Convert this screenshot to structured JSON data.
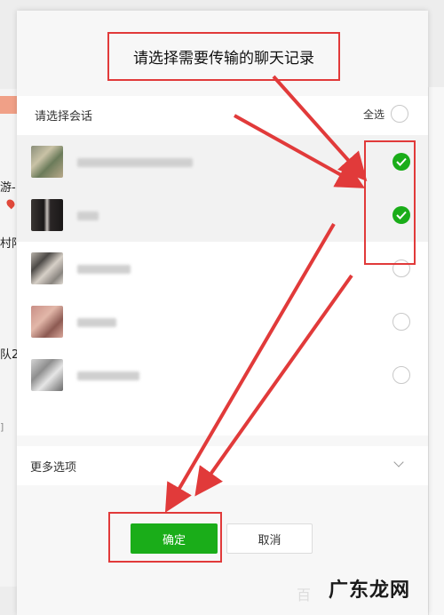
{
  "dialog": {
    "title": "请选择需要传输的聊天记录",
    "list_label": "请选择会话",
    "select_all_label": "全选",
    "more_options_label": "更多选项",
    "confirm_label": "确定",
    "cancel_label": "取消"
  },
  "chats": [
    {
      "name": "",
      "selected": true
    },
    {
      "name": "",
      "selected": true
    },
    {
      "name": "",
      "selected": false
    },
    {
      "name": "",
      "selected": false
    },
    {
      "name": "",
      "selected": false
    }
  ],
  "background": {
    "snippets": [
      "游-",
      "村阳",
      "队2",
      "]"
    ]
  },
  "watermark": "广东龙网",
  "watermark_ghost": "百",
  "colors": {
    "accent_green": "#1aad19",
    "annotation_red": "#e13a3a"
  },
  "icons": [
    "check-icon",
    "chevron-down-icon",
    "location-pin-icon"
  ]
}
